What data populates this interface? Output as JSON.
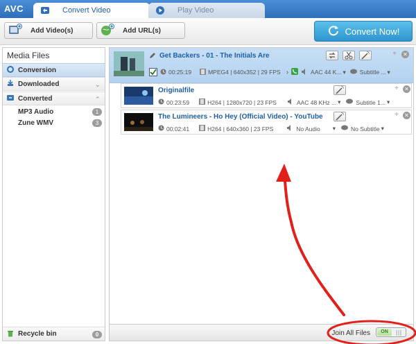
{
  "app": {
    "logo": "AVC"
  },
  "tabs": [
    {
      "label": "Convert Video",
      "icon": "convert-icon"
    },
    {
      "label": "Play Video",
      "icon": "play-icon"
    }
  ],
  "toolbar": {
    "add_video": "Add Video(s)",
    "add_url": "Add URL(s)",
    "convert_now": "Convert Now!"
  },
  "sidebar": {
    "title": "Media Files",
    "conversion": "Conversion",
    "downloaded": "Downloaded",
    "converted": "Converted",
    "items": [
      {
        "label": "MP3 Audio",
        "count": "1"
      },
      {
        "label": "Zune WMV",
        "count": "3"
      }
    ],
    "recycle": {
      "label": "Recycle bin",
      "count": "0"
    }
  },
  "files": {
    "parent": {
      "title": "Get Backers - 01 - The Initials Are",
      "duration": "00:25:19",
      "video": "MPEG4 | 640x352 | 29 FPS",
      "audio": "AAC 44 K...",
      "subtitle": "Subtitle ..."
    },
    "children": [
      {
        "title": "Originalfile",
        "duration": "00:23:59",
        "video": "H264 | 1280x720 | 23 FPS",
        "audio": "AAC 48 KHz ...",
        "subtitle": "Subtitle 1..."
      },
      {
        "title": "The Lumineers - Ho Hey (Official Video) - YouTube",
        "duration": "00:02:41",
        "video": "H264 | 640x360 | 23 FPS",
        "audio": "No Audio",
        "subtitle": "No Subtitle"
      }
    ]
  },
  "bottom": {
    "join_label": "Join All Files",
    "toggle_on": "ON"
  },
  "colors": {
    "accent": "#2f6fb9",
    "convert_button": "#2e95cf",
    "annotation": "#e0201b"
  }
}
